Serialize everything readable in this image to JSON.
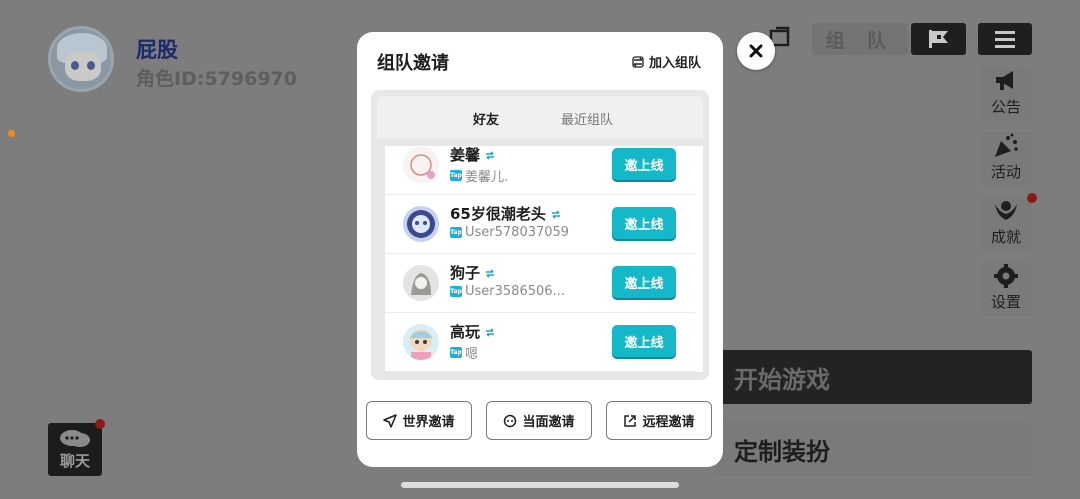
{
  "player": {
    "name": "屁股",
    "id_text": "角色ID:5796970"
  },
  "topbar": {
    "mode_label": "组 队"
  },
  "side_menu": [
    {
      "label": "公告",
      "icon": "megaphone-icon"
    },
    {
      "label": "活动",
      "icon": "party-popper-icon"
    },
    {
      "label": "成就",
      "icon": "laurel-icon"
    },
    {
      "label": "设置",
      "icon": "gear-icon"
    }
  ],
  "main_buttons": {
    "start": "开始游戏",
    "customize": "定制装扮"
  },
  "chat": {
    "label": "聊天"
  },
  "modal": {
    "title": "组队邀请",
    "join_label": "加入组队",
    "tabs": [
      {
        "label": "好友"
      },
      {
        "label": "最近组队"
      }
    ],
    "friends": [
      {
        "name": "姜馨",
        "sub": "姜馨儿.",
        "invite": "邀上线"
      },
      {
        "name": "65岁很潮老头",
        "sub": "User578037059",
        "invite": "邀上线"
      },
      {
        "name": "狗子",
        "sub": "User3586506...",
        "invite": "邀上线"
      },
      {
        "name": "高玩",
        "sub": "嗯",
        "invite": "邀上线"
      }
    ],
    "badge_text": "Tap",
    "bottom": {
      "world": "世界邀请",
      "face": "当面邀请",
      "remote": "远程邀请"
    }
  },
  "colors": {
    "accent": "#14b8c8",
    "overlay": "#7d7d7d",
    "notify_dot": "#8b1a14"
  }
}
